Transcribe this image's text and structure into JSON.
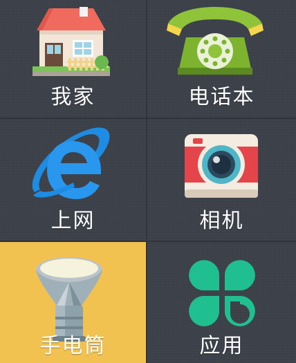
{
  "tiles": {
    "home": {
      "label": "我家",
      "icon": "house-icon"
    },
    "phonebook": {
      "label": "电话本",
      "icon": "telephone-icon"
    },
    "internet": {
      "label": "上网",
      "icon": "internet-explorer-icon"
    },
    "camera": {
      "label": "相机",
      "icon": "camera-icon"
    },
    "flashlight": {
      "label": "手电筒",
      "icon": "flashlight-icon",
      "selected": true
    },
    "apps": {
      "label": "应用",
      "icon": "clover-apps-icon"
    }
  },
  "colors": {
    "background": "#3b4049",
    "highlight": "#f1c24f",
    "label": "#ffffff"
  }
}
